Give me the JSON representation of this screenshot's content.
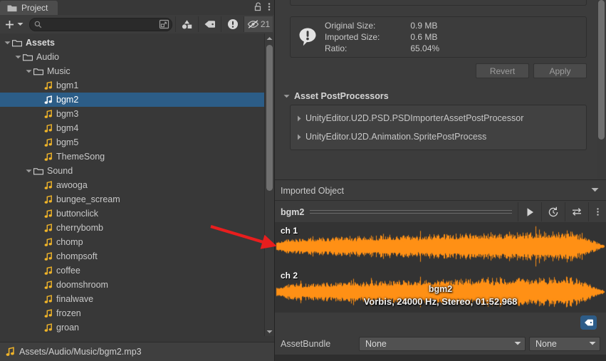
{
  "project_panel": {
    "tab_label": "Project",
    "tab_icon": "folder-icon",
    "lock_icon": "lock-open-icon",
    "menu_icon": "kebab-menu-icon",
    "toolbar": {
      "add_label": "+",
      "add_dropdown_icon": "chevron-down-icon",
      "search_placeholder": "",
      "search_value": "",
      "search_icon": "search-icon",
      "expand_icon": "expand-search-icon",
      "filter_type_icon": "filter-by-type-icon",
      "filter_label_icon": "filter-by-label-icon",
      "warning_icon": "warning-icon",
      "hidden_icon": "eye-crossed-icon",
      "hidden_count": "21"
    },
    "tree": [
      {
        "label": "Assets",
        "indent": 0,
        "type": "folder",
        "expanded": true,
        "selected": false,
        "bold": true
      },
      {
        "label": "Audio",
        "indent": 1,
        "type": "folder",
        "expanded": true,
        "selected": false,
        "bold": false
      },
      {
        "label": "Music",
        "indent": 2,
        "type": "folder",
        "expanded": true,
        "selected": false,
        "bold": false
      },
      {
        "label": "bgm1",
        "indent": 3,
        "type": "audio",
        "expanded": null,
        "selected": false,
        "bold": false
      },
      {
        "label": "bgm2",
        "indent": 3,
        "type": "audio",
        "expanded": null,
        "selected": true,
        "bold": false
      },
      {
        "label": "bgm3",
        "indent": 3,
        "type": "audio",
        "expanded": null,
        "selected": false,
        "bold": false
      },
      {
        "label": "bgm4",
        "indent": 3,
        "type": "audio",
        "expanded": null,
        "selected": false,
        "bold": false
      },
      {
        "label": "bgm5",
        "indent": 3,
        "type": "audio",
        "expanded": null,
        "selected": false,
        "bold": false
      },
      {
        "label": "ThemeSong",
        "indent": 3,
        "type": "audio",
        "expanded": null,
        "selected": false,
        "bold": false
      },
      {
        "label": "Sound",
        "indent": 2,
        "type": "folder",
        "expanded": true,
        "selected": false,
        "bold": false
      },
      {
        "label": "awooga",
        "indent": 3,
        "type": "audio",
        "expanded": null,
        "selected": false,
        "bold": false
      },
      {
        "label": "bungee_scream",
        "indent": 3,
        "type": "audio",
        "expanded": null,
        "selected": false,
        "bold": false
      },
      {
        "label": "buttonclick",
        "indent": 3,
        "type": "audio",
        "expanded": null,
        "selected": false,
        "bold": false
      },
      {
        "label": "cherrybomb",
        "indent": 3,
        "type": "audio",
        "expanded": null,
        "selected": false,
        "bold": false
      },
      {
        "label": "chomp",
        "indent": 3,
        "type": "audio",
        "expanded": null,
        "selected": false,
        "bold": false
      },
      {
        "label": "chompsoft",
        "indent": 3,
        "type": "audio",
        "expanded": null,
        "selected": false,
        "bold": false
      },
      {
        "label": "coffee",
        "indent": 3,
        "type": "audio",
        "expanded": null,
        "selected": false,
        "bold": false
      },
      {
        "label": "doomshroom",
        "indent": 3,
        "type": "audio",
        "expanded": null,
        "selected": false,
        "bold": false
      },
      {
        "label": "finalwave",
        "indent": 3,
        "type": "audio",
        "expanded": null,
        "selected": false,
        "bold": false
      },
      {
        "label": "frozen",
        "indent": 3,
        "type": "audio",
        "expanded": null,
        "selected": false,
        "bold": false
      },
      {
        "label": "groan",
        "indent": 3,
        "type": "audio",
        "expanded": null,
        "selected": false,
        "bold": false
      }
    ],
    "status_bar": {
      "icon": "audio-file-icon",
      "path": "Assets/Audio/Music/bgm2.mp3"
    }
  },
  "inspector": {
    "import_info": {
      "icon": "info-exclamation-icon",
      "labels": [
        "Original Size:",
        "Imported Size:",
        "Ratio:"
      ],
      "values": [
        "0.9 MB",
        "0.6 MB",
        "65.04%"
      ]
    },
    "buttons": {
      "revert": "Revert",
      "apply": "Apply"
    },
    "postprocessors": {
      "title": "Asset PostProcessors",
      "foldout_icon": "triangle-down-icon",
      "items": [
        "UnityEditor.U2D.PSD.PSDImporterAssetPostProcessor",
        "UnityEditor.U2D.Animation.SpritePostProcess"
      ]
    },
    "imported_object": {
      "title": "Imported Object",
      "dropdown_icon": "triangle-down-icon"
    },
    "player": {
      "asset_name": "bgm2",
      "play_icon": "play-icon",
      "rewind_icon": "replay-icon",
      "loop_icon": "loop-icon",
      "menu_icon": "kebab-menu-icon"
    },
    "waveform": {
      "channel1_label": "ch 1",
      "channel2_label": "ch 2",
      "overlay_title": "bgm2",
      "overlay_subtitle": "Vorbis, 24000 Hz, Stereo, 01:52.968",
      "wave_color": "#FF9015"
    },
    "asset_bundle": {
      "label": "AssetBundle",
      "name_value": "None",
      "variant_value": "None",
      "tag_icon": "label-tag-icon",
      "dropdown_icon": "chevron-down-icon"
    }
  },
  "annotation": {
    "arrow_color": "#E81E1E",
    "arrow_name": "red-pointer-arrow"
  },
  "colors": {
    "selection_blue": "#2C5D87",
    "panel_bg": "#3C3C3C",
    "tree_bg": "#383838",
    "waveform_orange": "#FF9015",
    "accent_tag_blue": "#2D5C88"
  }
}
